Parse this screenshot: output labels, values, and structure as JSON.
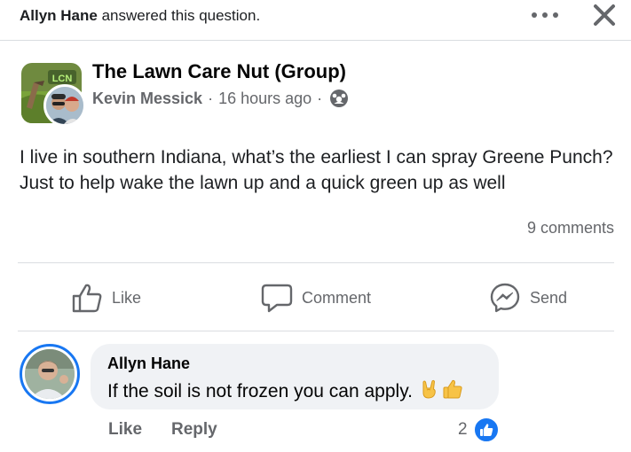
{
  "topbar": {
    "actor": "Allyn Hane",
    "action_text": " answered this question."
  },
  "post": {
    "group_name": "The Lawn Care Nut (Group)",
    "group_logo_text": "LCN",
    "author": "Kevin Messick",
    "separator": "·",
    "time": "16 hours ago",
    "audience_icon": "group-members-icon",
    "text": "I live in southern Indiana, what’s the earliest I can spray Greene Punch? Just to help wake the lawn up and a quick green up as well",
    "comment_count": "9 comments"
  },
  "actions": {
    "like": "Like",
    "comment": "Comment",
    "send": "Send"
  },
  "comment": {
    "author": "Allyn Hane",
    "text": "If the soil is not frozen you can apply.",
    "emojis": [
      "sign-of-horns-emoji",
      "thumbs-up-emoji"
    ],
    "like_label": "Like",
    "reply_label": "Reply",
    "reaction_count": "2",
    "reaction_type": "like"
  },
  "colors": {
    "accent": "#1877f2",
    "secondary_text": "#65676b",
    "bubble": "#f0f2f5"
  }
}
